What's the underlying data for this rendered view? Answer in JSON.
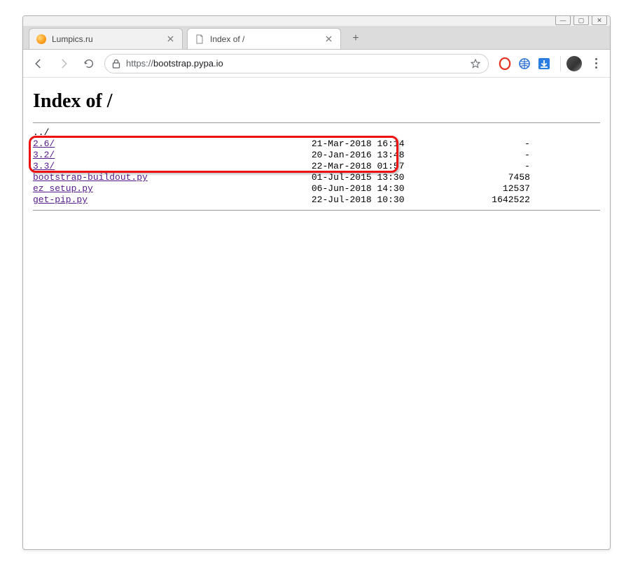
{
  "window": {
    "controls": {
      "min": "—",
      "max": "▢",
      "close": "✕"
    }
  },
  "tabs": [
    {
      "title": "Lumpics.ru",
      "favicon": "orange",
      "active": false
    },
    {
      "title": "Index of /",
      "favicon": "page",
      "active": true
    }
  ],
  "newtab_label": "+",
  "toolbar": {
    "url_proto": "https://",
    "url_host": "bootstrap.pypa.io"
  },
  "page": {
    "heading": "Index of /",
    "entries": [
      {
        "name": "../",
        "date": "",
        "size": "",
        "link": false
      },
      {
        "name": "2.6/",
        "date": "21-Mar-2018 16:14",
        "size": "-",
        "link": true,
        "visited": true
      },
      {
        "name": "3.2/",
        "date": "20-Jan-2016 13:48",
        "size": "-",
        "link": true,
        "visited": true
      },
      {
        "name": "3.3/",
        "date": "22-Mar-2018 01:57",
        "size": "-",
        "link": true,
        "visited": true
      },
      {
        "name": "bootstrap-buildout.py",
        "date": "01-Jul-2015 13:30",
        "size": "7458",
        "link": true,
        "visited": true
      },
      {
        "name": "ez_setup.py",
        "date": "06-Jun-2018 14:30",
        "size": "12537",
        "link": true,
        "visited": true
      },
      {
        "name": "get-pip.py",
        "date": "22-Jul-2018 10:30",
        "size": "1642522",
        "link": true,
        "visited": true
      }
    ]
  },
  "highlight": {
    "top_row": 1,
    "bottom_row": 3
  }
}
